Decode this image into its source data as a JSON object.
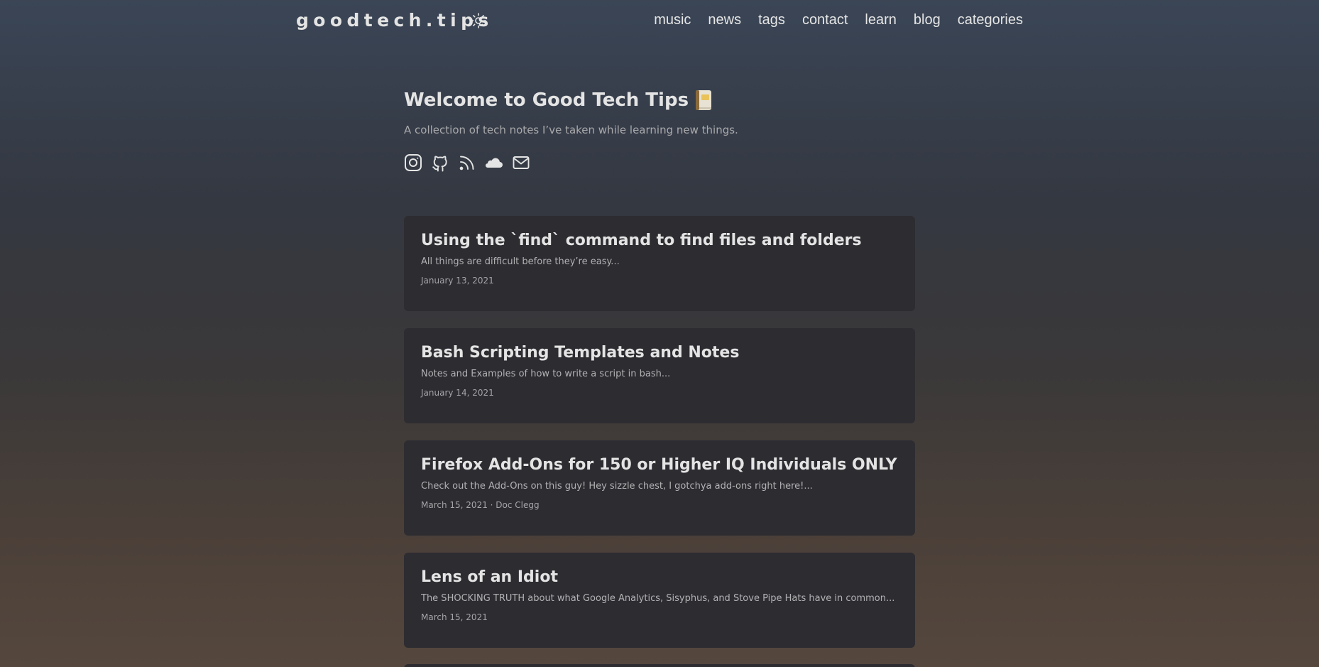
{
  "header": {
    "logo": "goodtech.tips",
    "theme_icon": "sun-icon",
    "nav": [
      "music",
      "news",
      "tags",
      "contact",
      "learn",
      "blog",
      "categories"
    ]
  },
  "intro": {
    "title": "Welcome to Good Tech Tips",
    "title_icon": "book-icon",
    "subtitle": "A collection of tech notes I’ve taken while learning new things.",
    "socials": [
      "instagram-icon",
      "github-icon",
      "rss-icon",
      "soundcloud-icon",
      "email-icon"
    ]
  },
  "posts": [
    {
      "title": "Using the `find` command to find files and folders",
      "excerpt": "All things are difficult before they’re easy...",
      "meta": "January 13, 2021"
    },
    {
      "title": "Bash Scripting Templates and Notes",
      "excerpt": "Notes and Examples of how to write a script in bash...",
      "meta": "January 14, 2021"
    },
    {
      "title": "Firefox Add-Ons for 150 or Higher IQ Individuals ONLY",
      "excerpt": "Check out the Add-Ons on this guy! Hey sizzle chest, I gotchya add-ons right here!...",
      "meta": "March 15, 2021 · Doc Clegg"
    },
    {
      "title": "Lens of an Idiot",
      "excerpt": "The SHOCKING TRUTH about what Google Analytics, Sisyphus, and Stove Pipe Hats have in common...",
      "meta": "March 15, 2021"
    }
  ],
  "colors": {
    "card_bg": "#2d2c31",
    "text": "#e4e4e4",
    "muted": "#a9a9ab",
    "gradient_top": "#3a4556",
    "gradient_bottom": "#55473d"
  }
}
